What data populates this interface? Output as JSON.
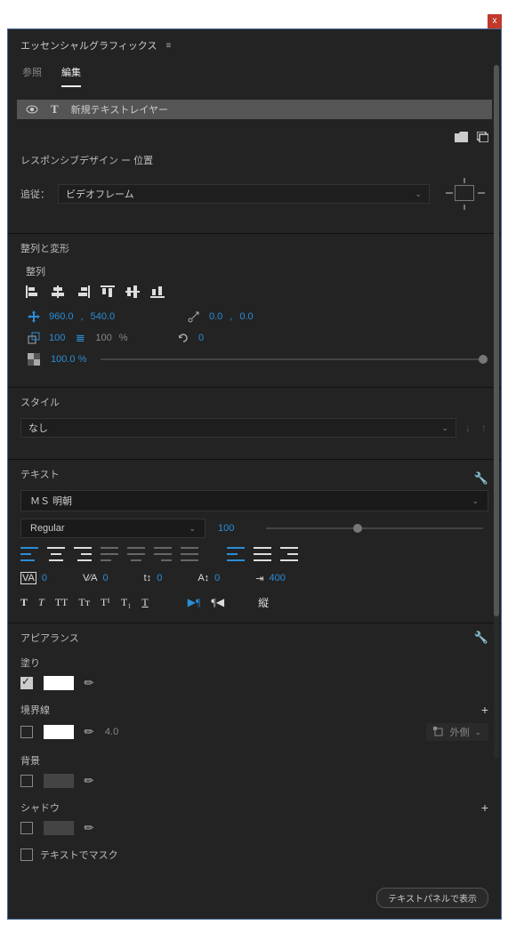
{
  "close_label": "x",
  "panel": {
    "title": "エッセンシャルグラフィックス"
  },
  "tabs": {
    "browse": "参照",
    "edit": "編集"
  },
  "layer": {
    "name": "新規テキストレイヤー"
  },
  "responsive": {
    "title": "レスポンシブデザイン ー 位置",
    "follow_label": "追従：",
    "follow_value": "ビデオフレーム"
  },
  "align_transform": {
    "title": "整列と変形",
    "align_label": "整列",
    "pos_x": "960.0",
    "pos_sep": ",",
    "pos_y": "540.0",
    "anchor_x": "0.0",
    "anchor_sep": ",",
    "anchor_y": "0.0",
    "scale": "100",
    "scale_linked": "100",
    "percent": "%",
    "rotation": "0",
    "opacity": "100.0 %"
  },
  "style": {
    "title": "スタイル",
    "value": "なし"
  },
  "text": {
    "title": "テキスト",
    "font": "ＭＳ 明朝",
    "weight": "Regular",
    "size": "100",
    "tracking_va": "0",
    "kerning_va": "0",
    "leading": "0",
    "baseline": "0",
    "tsume": "400"
  },
  "appearance": {
    "title": "アピアランス",
    "fill": "塗り",
    "stroke": "境界線",
    "stroke_width": "4.0",
    "stroke_pos": "外側",
    "background": "背景",
    "shadow": "シャドウ",
    "mask": "テキストでマスク"
  },
  "footer": {
    "show_text_panel": "テキストパネルで表示"
  }
}
